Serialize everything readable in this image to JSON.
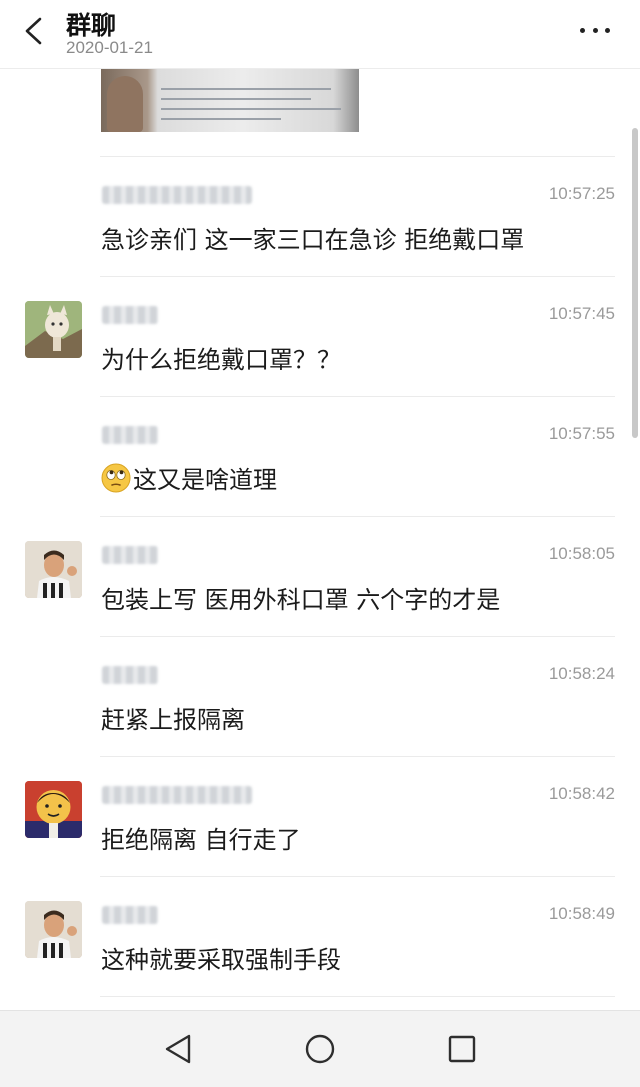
{
  "header": {
    "title": "群聊",
    "date": "2020-01-21"
  },
  "messages": [
    {
      "time": "10:57:25",
      "text": "急诊亲们 这一家三口在急诊 拒绝戴口罩",
      "has_avatar": false
    },
    {
      "time": "10:57:45",
      "text": "为什么拒绝戴口罩？？",
      "has_avatar": true,
      "avatar": "cat-photo"
    },
    {
      "time": "10:57:55",
      "text": "这又是啥道理",
      "has_avatar": false,
      "emoji": "rolling-eyes-emoji"
    },
    {
      "time": "10:58:05",
      "text": "包装上写 医用外科口罩 六个字的才是",
      "has_avatar": true,
      "avatar": "player-photo"
    },
    {
      "time": "10:58:24",
      "text": "赶紧上报隔离",
      "has_avatar": false
    },
    {
      "time": "10:58:42",
      "text": "拒绝隔离 自行走了",
      "has_avatar": true,
      "avatar": "cartoon-yellow"
    },
    {
      "time": "10:58:49",
      "text": "这种就要采取强制手段",
      "has_avatar": true,
      "avatar": "player-photo"
    }
  ],
  "navbar": {
    "back_icon": "triangle-back-icon",
    "home_icon": "circle-home-icon",
    "recents_icon": "square-recents-icon"
  },
  "colors": {
    "time": "#9a9a9a",
    "divider": "#ebebeb",
    "navbar_bg": "#f3f3f3"
  }
}
